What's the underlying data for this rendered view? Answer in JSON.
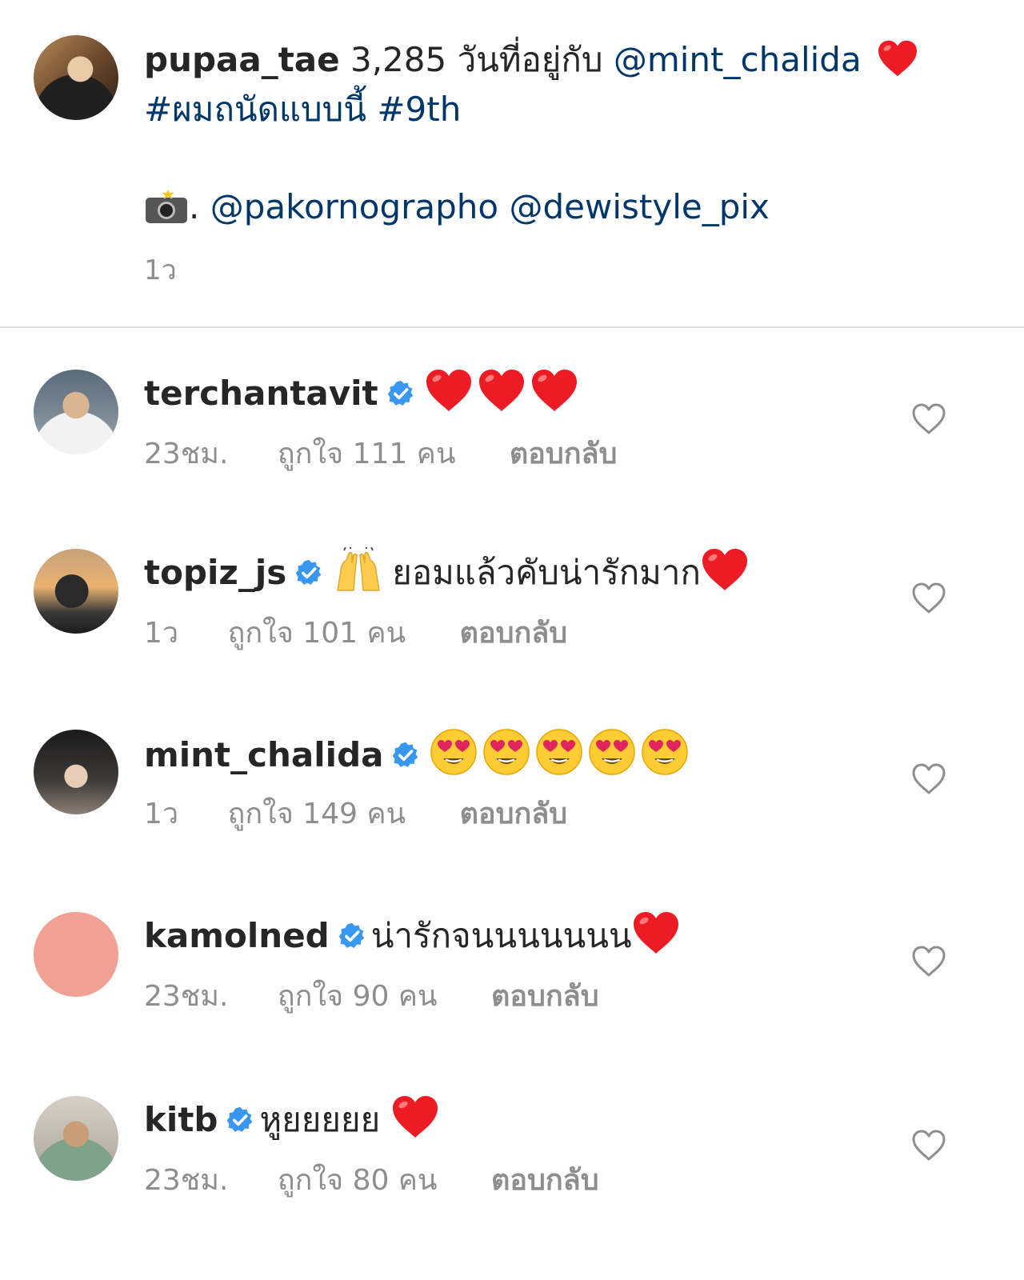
{
  "caption": {
    "username": "pupaa_tae",
    "text_before_mention": "3,285 วันที่อยู่กับ",
    "mention": "@mint_chalida",
    "hashtags": "#ผมถนัดแบบนี้ #9th",
    "photo_credit_prefix": ".",
    "photo_credits": "@pakornographo @dewistyle_pix",
    "time": "1ว"
  },
  "comments": [
    {
      "username": "terchantavit",
      "verified": true,
      "text": "",
      "time": "23ชม.",
      "likes": "ถูกใจ 111 คน",
      "reply": "ตอบกลับ"
    },
    {
      "username": "topiz_js",
      "verified": true,
      "text": "ยอมแล้วคับน่ารักมาก",
      "time": "1ว",
      "likes": "ถูกใจ 101 คน",
      "reply": "ตอบกลับ"
    },
    {
      "username": "mint_chalida",
      "verified": true,
      "text": "",
      "time": "1ว",
      "likes": "ถูกใจ 149 คน",
      "reply": "ตอบกลับ"
    },
    {
      "username": "kamolned",
      "verified": true,
      "text": "น่ารักจนนนนนนน",
      "time": "23ชม.",
      "likes": "ถูกใจ 90 คน",
      "reply": "ตอบกลับ"
    },
    {
      "username": "kitb",
      "verified": true,
      "text": "หูยยยยย",
      "time": "23ชม.",
      "likes": "ถูกใจ 80 คน",
      "reply": "ตอบกลับ"
    }
  ],
  "colors": {
    "link": "#00376b",
    "meta_text": "#8e8e8e",
    "verified_badge": "#3897f0",
    "heart_red": "#ed1c24",
    "divider": "#dbdbdb"
  },
  "icons": {
    "verified": "verified-badge-icon",
    "like": "heart-outline-icon",
    "camera": "camera-flash-icon"
  }
}
